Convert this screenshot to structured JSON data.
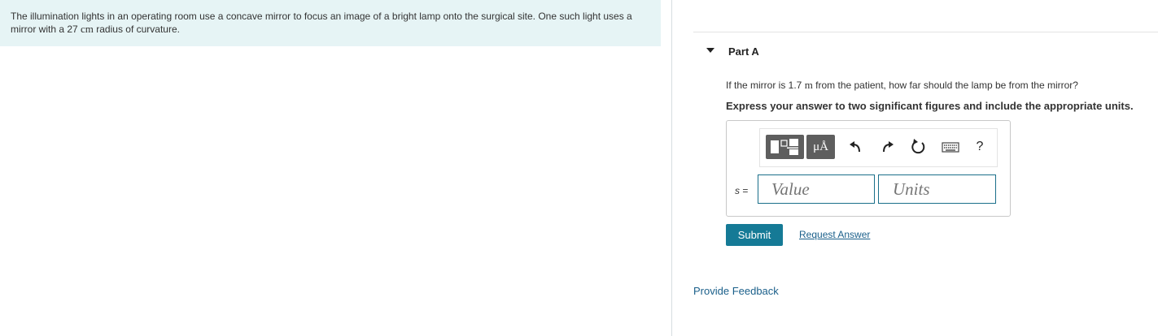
{
  "problem": {
    "text_before": "The illumination lights in an operating room use a concave mirror to focus an image of a bright lamp onto the surgical site. One such light uses a mirror with a 27 ",
    "unit": "cm",
    "text_after": " radius of curvature."
  },
  "part": {
    "title": "Part A",
    "question_before": "If the mirror is 1.7 ",
    "question_unit": "m",
    "question_after": " from the patient, how far should the lamp be from the mirror?",
    "instruction": "Express your answer to two significant figures and include the appropriate units."
  },
  "answer": {
    "variable": "s",
    "equals": " =",
    "value_placeholder": "Value",
    "units_placeholder": "Units"
  },
  "toolbar": {
    "units_label": "μÅ",
    "help_label": "?"
  },
  "actions": {
    "submit": "Submit",
    "request_answer": "Request Answer",
    "provide_feedback": "Provide Feedback"
  },
  "colors": {
    "problem_bg": "#e6f4f5",
    "submit_bg": "#157a96",
    "link": "#1a5f8a",
    "input_border": "#1a6f8a",
    "toolbar_btn": "#5e5e5e"
  }
}
